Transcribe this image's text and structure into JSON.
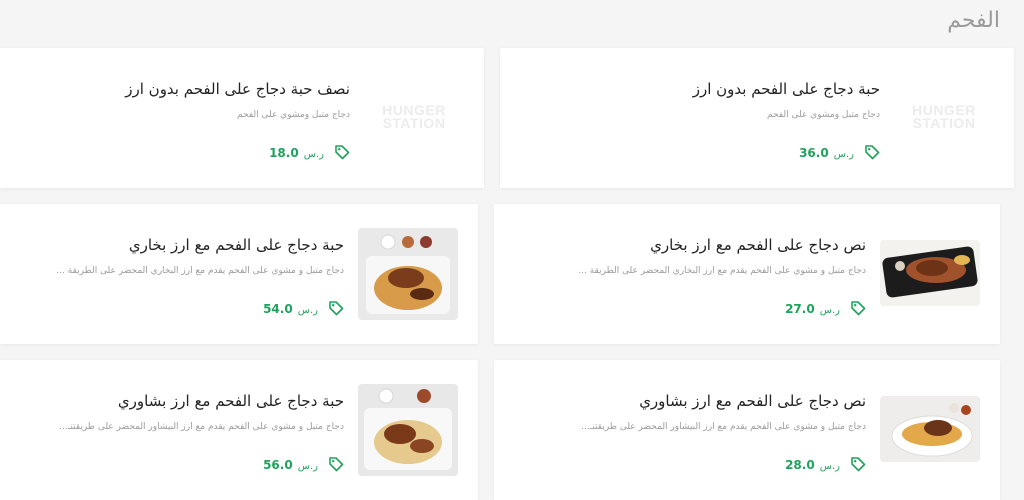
{
  "section": {
    "title": "الفحم"
  },
  "items": [
    {
      "name": "حبة دجاج على الفحم بدون ارز",
      "desc": "دجاج متبل ومشوي على الفحم",
      "price": "36.0",
      "currency": "ر.س"
    },
    {
      "name": "نصف حبة دجاج على الفحم بدون ارز",
      "desc": "دجاج متبل ومشوي على الفحم",
      "price": "18.0",
      "currency": "ر.س"
    },
    {
      "name": "نص دجاج على الفحم مع ارز بخاري",
      "desc": "دجاج متبل و مشوي على الفحم يقدم مع ارز البخاري المحضر على الطريقة ...",
      "price": "27.0",
      "currency": "ر.س"
    },
    {
      "name": "حبة دجاج على الفحم مع ارز بخاري",
      "desc": "دجاج متبل و مشوي على الفحم يقدم مع ارز البخاري المحضر على الطريقة ...",
      "price": "54.0",
      "currency": "ر.س"
    },
    {
      "name": "نص دجاج على الفحم مع ارز بشاوري",
      "desc": "دجاج متبل و مشوي على الفحم يقدم مع ارز البيشاور المحضر على طريقتنـ...",
      "price": "28.0",
      "currency": "ر.س"
    },
    {
      "name": "حبة دجاج على الفحم مع ارز بشاوري",
      "desc": "دجاج متبل و مشوي على الفحم يقدم مع ارز البيشاور المحضر على طريقتنـ...",
      "price": "56.0",
      "currency": "ر.س"
    }
  ],
  "placeholder_logo": {
    "line1": "HUNGER",
    "line2": "STATION"
  },
  "colors": {
    "accent": "#1fa35c",
    "text": "#222222",
    "muted": "#9b9b9b"
  },
  "icons": {
    "price": "price-tag-icon"
  }
}
